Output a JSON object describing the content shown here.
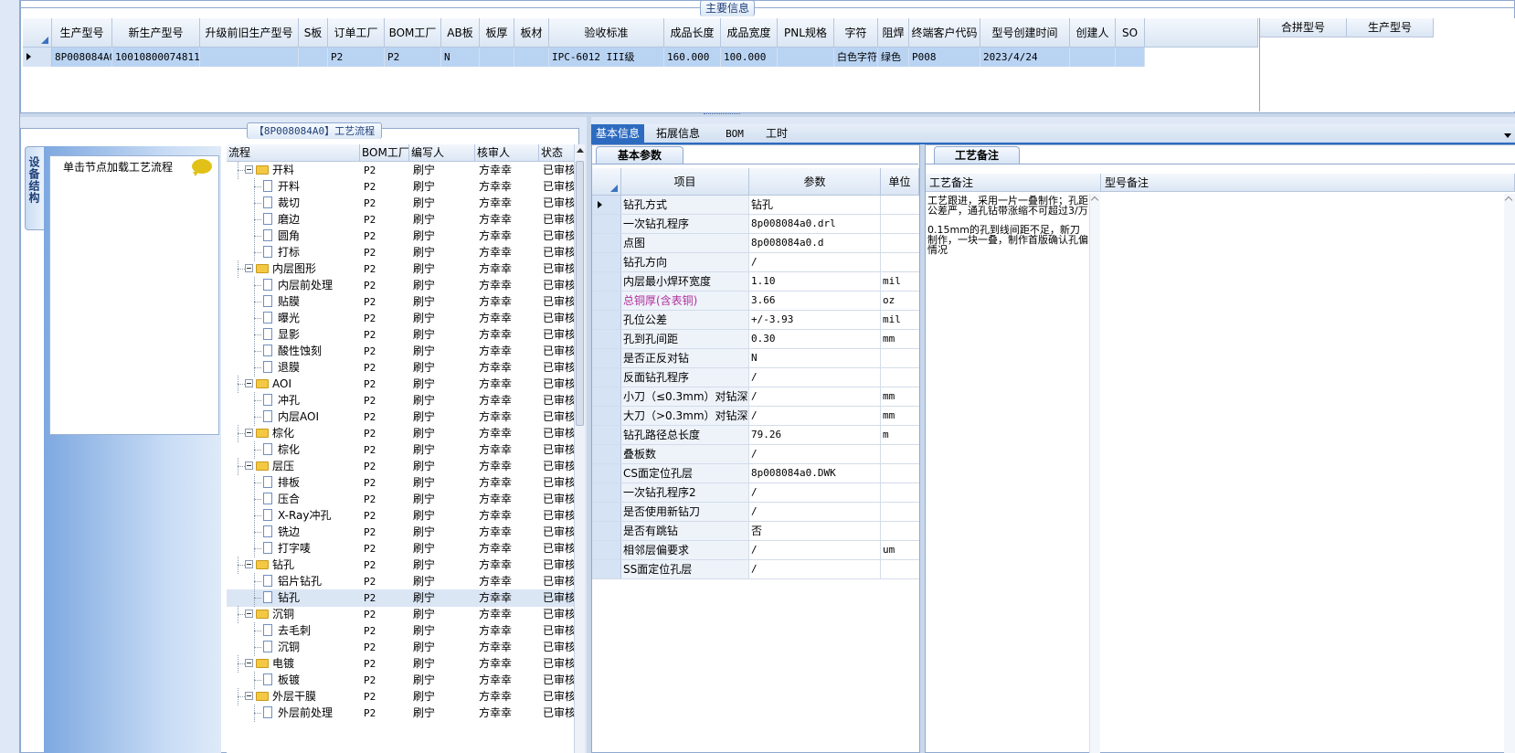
{
  "main_info": {
    "title": "主要信息",
    "columns": [
      "生产型号",
      "新生产型号",
      "升级前旧生产型号",
      "S板",
      "订单工厂",
      "BOM工厂",
      "AB板",
      "板厚",
      "板材",
      "验收标准",
      "成品长度",
      "成品宽度",
      "PNL规格",
      "字符",
      "阻焊",
      "终端客户代码",
      "型号创建时间",
      "创建人",
      "SO"
    ],
    "row": [
      "8P008084A0",
      "10010800074811",
      "",
      "",
      "P2",
      "P2",
      "N",
      "",
      "",
      "IPC-6012 III级",
      "160.000",
      "100.000",
      "",
      "白色字符",
      "绿色",
      "P008",
      "2023/4/24",
      "",
      ""
    ]
  },
  "merge_panel": {
    "columns": [
      "合拼型号",
      "生产型号"
    ]
  },
  "process": {
    "title": "【8P008084A0】工艺流程",
    "side_tab": "设备结构",
    "load_hint": "单击节点加载工艺流程",
    "columns": [
      "流程",
      "BOM工厂",
      "编写人",
      "核审人",
      "状态"
    ],
    "rows": [
      {
        "level": 0,
        "name": "开料",
        "bom": "P2",
        "writer": "刷宁",
        "reviewer": "方幸幸",
        "status": "已审核"
      },
      {
        "level": 1,
        "name": "开料",
        "bom": "P2",
        "writer": "刷宁",
        "reviewer": "方幸幸",
        "status": "已审核"
      },
      {
        "level": 1,
        "name": "裁切",
        "bom": "P2",
        "writer": "刷宁",
        "reviewer": "方幸幸",
        "status": "已审核"
      },
      {
        "level": 1,
        "name": "磨边",
        "bom": "P2",
        "writer": "刷宁",
        "reviewer": "方幸幸",
        "status": "已审核"
      },
      {
        "level": 1,
        "name": "圆角",
        "bom": "P2",
        "writer": "刷宁",
        "reviewer": "方幸幸",
        "status": "已审核"
      },
      {
        "level": 1,
        "name": "打标",
        "bom": "P2",
        "writer": "刷宁",
        "reviewer": "方幸幸",
        "status": "已审核"
      },
      {
        "level": 0,
        "name": "内层图形",
        "bom": "P2",
        "writer": "刷宁",
        "reviewer": "方幸幸",
        "status": "已审核"
      },
      {
        "level": 1,
        "name": "内层前处理",
        "bom": "P2",
        "writer": "刷宁",
        "reviewer": "方幸幸",
        "status": "已审核"
      },
      {
        "level": 1,
        "name": "贴膜",
        "bom": "P2",
        "writer": "刷宁",
        "reviewer": "方幸幸",
        "status": "已审核"
      },
      {
        "level": 1,
        "name": "曝光",
        "bom": "P2",
        "writer": "刷宁",
        "reviewer": "方幸幸",
        "status": "已审核"
      },
      {
        "level": 1,
        "name": "显影",
        "bom": "P2",
        "writer": "刷宁",
        "reviewer": "方幸幸",
        "status": "已审核"
      },
      {
        "level": 1,
        "name": "酸性蚀刻",
        "bom": "P2",
        "writer": "刷宁",
        "reviewer": "方幸幸",
        "status": "已审核"
      },
      {
        "level": 1,
        "name": "退膜",
        "bom": "P2",
        "writer": "刷宁",
        "reviewer": "方幸幸",
        "status": "已审核"
      },
      {
        "level": 0,
        "name": "AOI",
        "bom": "P2",
        "writer": "刷宁",
        "reviewer": "方幸幸",
        "status": "已审核"
      },
      {
        "level": 1,
        "name": "冲孔",
        "bom": "P2",
        "writer": "刷宁",
        "reviewer": "方幸幸",
        "status": "已审核"
      },
      {
        "level": 1,
        "name": "内层AOI",
        "bom": "P2",
        "writer": "刷宁",
        "reviewer": "方幸幸",
        "status": "已审核"
      },
      {
        "level": 0,
        "name": "棕化",
        "bom": "P2",
        "writer": "刷宁",
        "reviewer": "方幸幸",
        "status": "已审核"
      },
      {
        "level": 1,
        "name": "棕化",
        "bom": "P2",
        "writer": "刷宁",
        "reviewer": "方幸幸",
        "status": "已审核"
      },
      {
        "level": 0,
        "name": "层压",
        "bom": "P2",
        "writer": "刷宁",
        "reviewer": "方幸幸",
        "status": "已审核"
      },
      {
        "level": 1,
        "name": "排板",
        "bom": "P2",
        "writer": "刷宁",
        "reviewer": "方幸幸",
        "status": "已审核"
      },
      {
        "level": 1,
        "name": "压合",
        "bom": "P2",
        "writer": "刷宁",
        "reviewer": "方幸幸",
        "status": "已审核"
      },
      {
        "level": 1,
        "name": "X-Ray冲孔",
        "bom": "P2",
        "writer": "刷宁",
        "reviewer": "方幸幸",
        "status": "已审核"
      },
      {
        "level": 1,
        "name": "铣边",
        "bom": "P2",
        "writer": "刷宁",
        "reviewer": "方幸幸",
        "status": "已审核"
      },
      {
        "level": 1,
        "name": "打字唛",
        "bom": "P2",
        "writer": "刷宁",
        "reviewer": "方幸幸",
        "status": "已审核"
      },
      {
        "level": 0,
        "name": "钻孔",
        "bom": "P2",
        "writer": "刷宁",
        "reviewer": "方幸幸",
        "status": "已审核"
      },
      {
        "level": 1,
        "name": "铝片钻孔",
        "bom": "P2",
        "writer": "刷宁",
        "reviewer": "方幸幸",
        "status": "已审核"
      },
      {
        "level": 1,
        "name": "钻孔",
        "bom": "P2",
        "writer": "刷宁",
        "reviewer": "方幸幸",
        "status": "已审核",
        "selected": true
      },
      {
        "level": 0,
        "name": "沉铜",
        "bom": "P2",
        "writer": "刷宁",
        "reviewer": "方幸幸",
        "status": "已审核"
      },
      {
        "level": 1,
        "name": "去毛刺",
        "bom": "P2",
        "writer": "刷宁",
        "reviewer": "方幸幸",
        "status": "已审核"
      },
      {
        "level": 1,
        "name": "沉铜",
        "bom": "P2",
        "writer": "刷宁",
        "reviewer": "方幸幸",
        "status": "已审核"
      },
      {
        "level": 0,
        "name": "电镀",
        "bom": "P2",
        "writer": "刷宁",
        "reviewer": "方幸幸",
        "status": "已审核"
      },
      {
        "level": 1,
        "name": "板镀",
        "bom": "P2",
        "writer": "刷宁",
        "reviewer": "方幸幸",
        "status": "已审核"
      },
      {
        "level": 0,
        "name": "外层干膜",
        "bom": "P2",
        "writer": "刷宁",
        "reviewer": "方幸幸",
        "status": "已审核"
      },
      {
        "level": 1,
        "name": "外层前处理",
        "bom": "P2",
        "writer": "刷宁",
        "reviewer": "方幸幸",
        "status": "已审核"
      }
    ]
  },
  "detail_tabs": [
    "基本信息",
    "拓展信息",
    "BOM",
    "工时"
  ],
  "basic_params": {
    "title": "基本参数",
    "columns": [
      "项目",
      "参数",
      "单位"
    ],
    "rows": [
      {
        "item": "钻孔方式",
        "value": "钻孔",
        "unit": "",
        "current": true
      },
      {
        "item": "一次钻孔程序",
        "value": "8p008084a0.drl",
        "unit": ""
      },
      {
        "item": "点图",
        "value": "8p008084a0.d",
        "unit": ""
      },
      {
        "item": "钻孔方向",
        "value": "/",
        "unit": ""
      },
      {
        "item": "内层最小焊环宽度",
        "value": "1.10",
        "unit": "mil"
      },
      {
        "item": "总铜厚(含表铜)",
        "value": "3.66",
        "unit": "oz",
        "highlight": true
      },
      {
        "item": "孔位公差",
        "value": "+/-3.93",
        "unit": "mil"
      },
      {
        "item": "孔到孔间距",
        "value": "0.30",
        "unit": "mm"
      },
      {
        "item": "是否正反对钻",
        "value": "N",
        "unit": ""
      },
      {
        "item": "反面钻孔程序",
        "value": "/",
        "unit": ""
      },
      {
        "item": "小刀（≤0.3mm）对钻深度",
        "value": "/",
        "unit": "mm"
      },
      {
        "item": "大刀（>0.3mm）对钻深度",
        "value": "/",
        "unit": "mm"
      },
      {
        "item": "钻孔路径总长度",
        "value": "79.26",
        "unit": "m"
      },
      {
        "item": "叠板数",
        "value": "/",
        "unit": ""
      },
      {
        "item": "CS面定位孔层",
        "value": "8p008084a0.DWK",
        "unit": ""
      },
      {
        "item": "一次钻孔程序2",
        "value": "/",
        "unit": ""
      },
      {
        "item": "是否使用新钻刀",
        "value": "/",
        "unit": ""
      },
      {
        "item": "是否有跳钻",
        "value": "否",
        "unit": ""
      },
      {
        "item": "相邻层偏要求",
        "value": "/",
        "unit": "um"
      },
      {
        "item": "SS面定位孔层",
        "value": "/",
        "unit": ""
      }
    ]
  },
  "process_notes": {
    "title": "工艺备注",
    "col1": "工艺备注",
    "col2": "型号备注",
    "note_line1": "工艺跟进，采用一片一叠制作；孔距公差严，通孔钻带涨缩不可超过3/万",
    "note_line2": "0.15mm的孔到线间距不足，新刀制作，一块一叠，制作首版确认孔偏情况"
  },
  "colors": {
    "selected_row": "#b9d3f3",
    "highlight_text": "#b0309a",
    "tab_active": "#2d6bc0"
  }
}
